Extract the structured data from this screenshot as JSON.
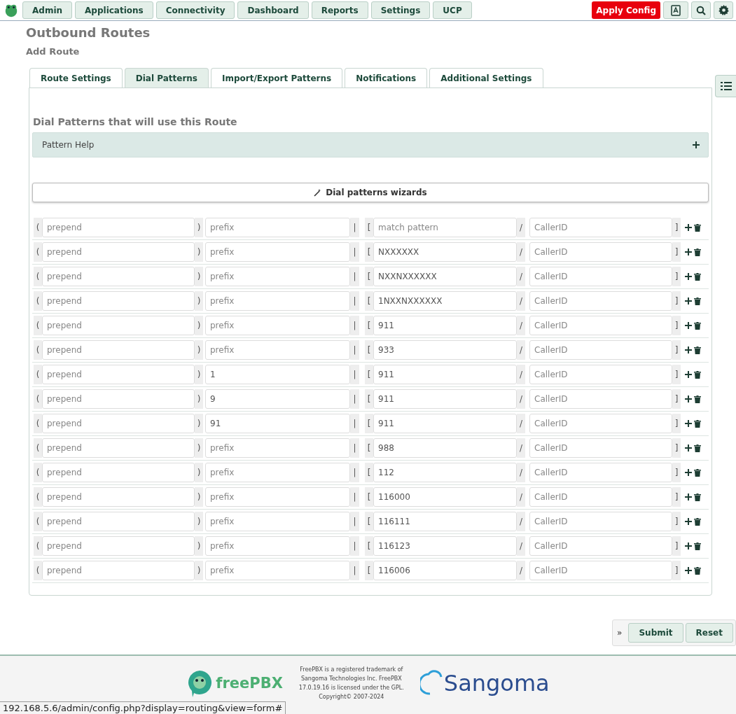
{
  "nav": {
    "items": [
      "Admin",
      "Applications",
      "Connectivity",
      "Dashboard",
      "Reports",
      "Settings",
      "UCP"
    ],
    "apply": "Apply Config"
  },
  "page": {
    "title": "Outbound Routes",
    "subtitle": "Add Route"
  },
  "tabs": [
    {
      "label": "Route Settings",
      "selected": false
    },
    {
      "label": "Dial Patterns",
      "selected": true
    },
    {
      "label": "Import/Export Patterns",
      "selected": false
    },
    {
      "label": "Notifications",
      "selected": false
    },
    {
      "label": "Additional Settings",
      "selected": false
    }
  ],
  "section_title": "Dial Patterns that will use this Route",
  "pattern_help": {
    "label": "Pattern Help",
    "expanded": false
  },
  "wizard_button": "Dial patterns wizards",
  "patterns": [
    {
      "marks": [
        "(",
        ")",
        "|",
        "[",
        "/",
        "]"
      ],
      "prepend": {
        "placeholder": "prepend"
      },
      "prefix": {
        "placeholder": "prefix"
      },
      "match": {
        "placeholder": "match pattern"
      },
      "callerid": {
        "placeholder": "CallerID"
      }
    },
    {
      "marks": [
        "(",
        ")",
        "|",
        "[",
        "/",
        "]"
      ],
      "prepend": {
        "placeholder": "prepend"
      },
      "prefix": {
        "placeholder": "prefix"
      },
      "match": {
        "value": "NXXXXXX"
      },
      "callerid": {
        "placeholder": "CallerID"
      }
    },
    {
      "marks": [
        "(",
        ")",
        "|",
        "[",
        "/",
        "]"
      ],
      "prepend": {
        "placeholder": "prepend"
      },
      "prefix": {
        "placeholder": "prefix"
      },
      "match": {
        "value": "NXXNXXXXXX"
      },
      "callerid": {
        "placeholder": "CallerID"
      }
    },
    {
      "marks": [
        "(",
        ")",
        "|",
        "[",
        "/",
        "]"
      ],
      "prepend": {
        "placeholder": "prepend"
      },
      "prefix": {
        "placeholder": "prefix"
      },
      "match": {
        "value": "1NXXNXXXXXX"
      },
      "callerid": {
        "placeholder": "CallerID"
      }
    },
    {
      "marks": [
        "(",
        ")",
        "|",
        "[",
        "/",
        "]"
      ],
      "prepend": {
        "placeholder": "prepend"
      },
      "prefix": {
        "placeholder": "prefix"
      },
      "match": {
        "value": "911"
      },
      "callerid": {
        "placeholder": "CallerID"
      }
    },
    {
      "marks": [
        "(",
        ")",
        "|",
        "[",
        "/",
        "]"
      ],
      "prepend": {
        "placeholder": "prepend"
      },
      "prefix": {
        "placeholder": "prefix"
      },
      "match": {
        "value": "933"
      },
      "callerid": {
        "placeholder": "CallerID"
      }
    },
    {
      "marks": [
        "(",
        ")",
        "|",
        "[",
        "/",
        "]"
      ],
      "prepend": {
        "placeholder": "prepend"
      },
      "prefix": {
        "value": "1"
      },
      "match": {
        "value": "911"
      },
      "callerid": {
        "placeholder": "CallerID"
      }
    },
    {
      "marks": [
        "(",
        ")",
        "|",
        "[",
        "/",
        "]"
      ],
      "prepend": {
        "placeholder": "prepend"
      },
      "prefix": {
        "value": "9"
      },
      "match": {
        "value": "911"
      },
      "callerid": {
        "placeholder": "CallerID"
      }
    },
    {
      "marks": [
        "(",
        ")",
        "|",
        "[",
        "/",
        "]"
      ],
      "prepend": {
        "placeholder": "prepend"
      },
      "prefix": {
        "value": "91"
      },
      "match": {
        "value": "911"
      },
      "callerid": {
        "placeholder": "CallerID"
      }
    },
    {
      "marks": [
        "(",
        ")",
        "|",
        "[",
        "/",
        "]"
      ],
      "prepend": {
        "placeholder": "prepend"
      },
      "prefix": {
        "placeholder": "prefix"
      },
      "match": {
        "value": "988"
      },
      "callerid": {
        "placeholder": "CallerID"
      }
    },
    {
      "marks": [
        "(",
        ")",
        "|",
        "[",
        "/",
        "]"
      ],
      "prepend": {
        "placeholder": "prepend"
      },
      "prefix": {
        "placeholder": "prefix"
      },
      "match": {
        "value": "112"
      },
      "callerid": {
        "placeholder": "CallerID"
      }
    },
    {
      "marks": [
        "(",
        ")",
        "|",
        "[",
        "/",
        "]"
      ],
      "prepend": {
        "placeholder": "prepend"
      },
      "prefix": {
        "placeholder": "prefix"
      },
      "match": {
        "value": "116000"
      },
      "callerid": {
        "placeholder": "CallerID"
      }
    },
    {
      "marks": [
        "(",
        ")",
        "|",
        "[",
        "/",
        "]"
      ],
      "prepend": {
        "placeholder": "prepend"
      },
      "prefix": {
        "placeholder": "prefix"
      },
      "match": {
        "value": "116111"
      },
      "callerid": {
        "placeholder": "CallerID"
      }
    },
    {
      "marks": [
        "(",
        ")",
        "|",
        "[",
        "/",
        "]"
      ],
      "prepend": {
        "placeholder": "prepend"
      },
      "prefix": {
        "placeholder": "prefix"
      },
      "match": {
        "value": "116123"
      },
      "callerid": {
        "placeholder": "CallerID"
      }
    },
    {
      "marks": [
        "(",
        ")",
        "|",
        "[",
        "/",
        "]"
      ],
      "prepend": {
        "placeholder": "prepend"
      },
      "prefix": {
        "placeholder": "prefix"
      },
      "match": {
        "value": "116006"
      },
      "callerid": {
        "placeholder": "CallerID"
      }
    }
  ],
  "actions": {
    "toggle": "»",
    "buttons": [
      "Submit",
      "Reset"
    ]
  },
  "footer": {
    "logo": "freePBX",
    "legal": "FreePBX is a registered trademark of Sangoma Technologies Inc. FreePBX 17.0.19.16 is licensed under the GPL. Copyright© 2007-2024",
    "brand": "Sangoma"
  },
  "status_url": "192.168.5.6/admin/config.php?display=routing&view=form#"
}
